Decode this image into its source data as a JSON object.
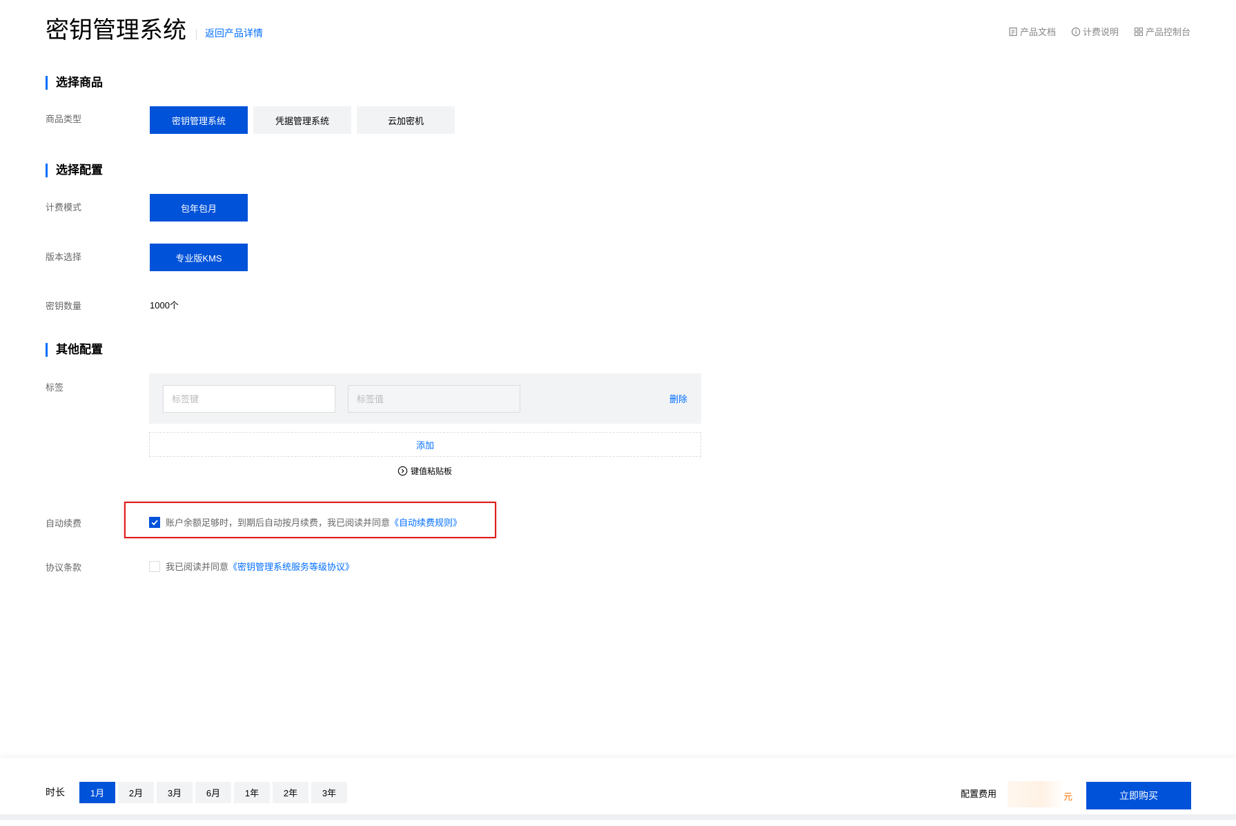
{
  "header": {
    "title": "密钥管理系统",
    "back_link": "返回产品详情",
    "links": [
      {
        "label": "产品文档",
        "icon": "document-icon"
      },
      {
        "label": "计费说明",
        "icon": "info-icon"
      },
      {
        "label": "产品控制台",
        "icon": "grid-icon"
      }
    ]
  },
  "select_product": {
    "title": "选择商品",
    "type_label": "商品类型",
    "options": [
      "密钥管理系统",
      "凭据管理系统",
      "云加密机"
    ],
    "selected": "密钥管理系统"
  },
  "select_config": {
    "title": "选择配置",
    "billing_label": "计费模式",
    "billing_option": "包年包月",
    "edition_label": "版本选择",
    "edition_option": "专业版KMS",
    "key_count_label": "密钥数量",
    "key_count_value": "1000个"
  },
  "other_config": {
    "title": "其他配置",
    "tag_label": "标签",
    "tag_key_placeholder": "标签键",
    "tag_value_placeholder": "标签值",
    "delete_label": "删除",
    "add_label": "添加",
    "clipboard_label": "键值粘贴板",
    "auto_renew_label": "自动续费",
    "auto_renew_text": "账户余额足够时，到期后自动按月续费，我已阅读并同意",
    "auto_renew_link": "《自动续费规则》",
    "auto_renew_checked": true,
    "agreement_label": "协议条款",
    "agreement_text": "我已阅读并同意",
    "agreement_link": "《密钥管理系统服务等级协议》",
    "agreement_checked": false
  },
  "bottom_bar": {
    "duration_label": "时长",
    "durations": [
      "1月",
      "2月",
      "3月",
      "6月",
      "1年",
      "2年",
      "3年"
    ],
    "selected_duration": "1月",
    "fee_label": "配置费用",
    "fee_unit": "元",
    "buy_label": "立即购买"
  },
  "colors": {
    "primary": "#0052d9",
    "link": "#006eff",
    "highlight_border": "#e01c1c",
    "price": "#ff7200"
  }
}
